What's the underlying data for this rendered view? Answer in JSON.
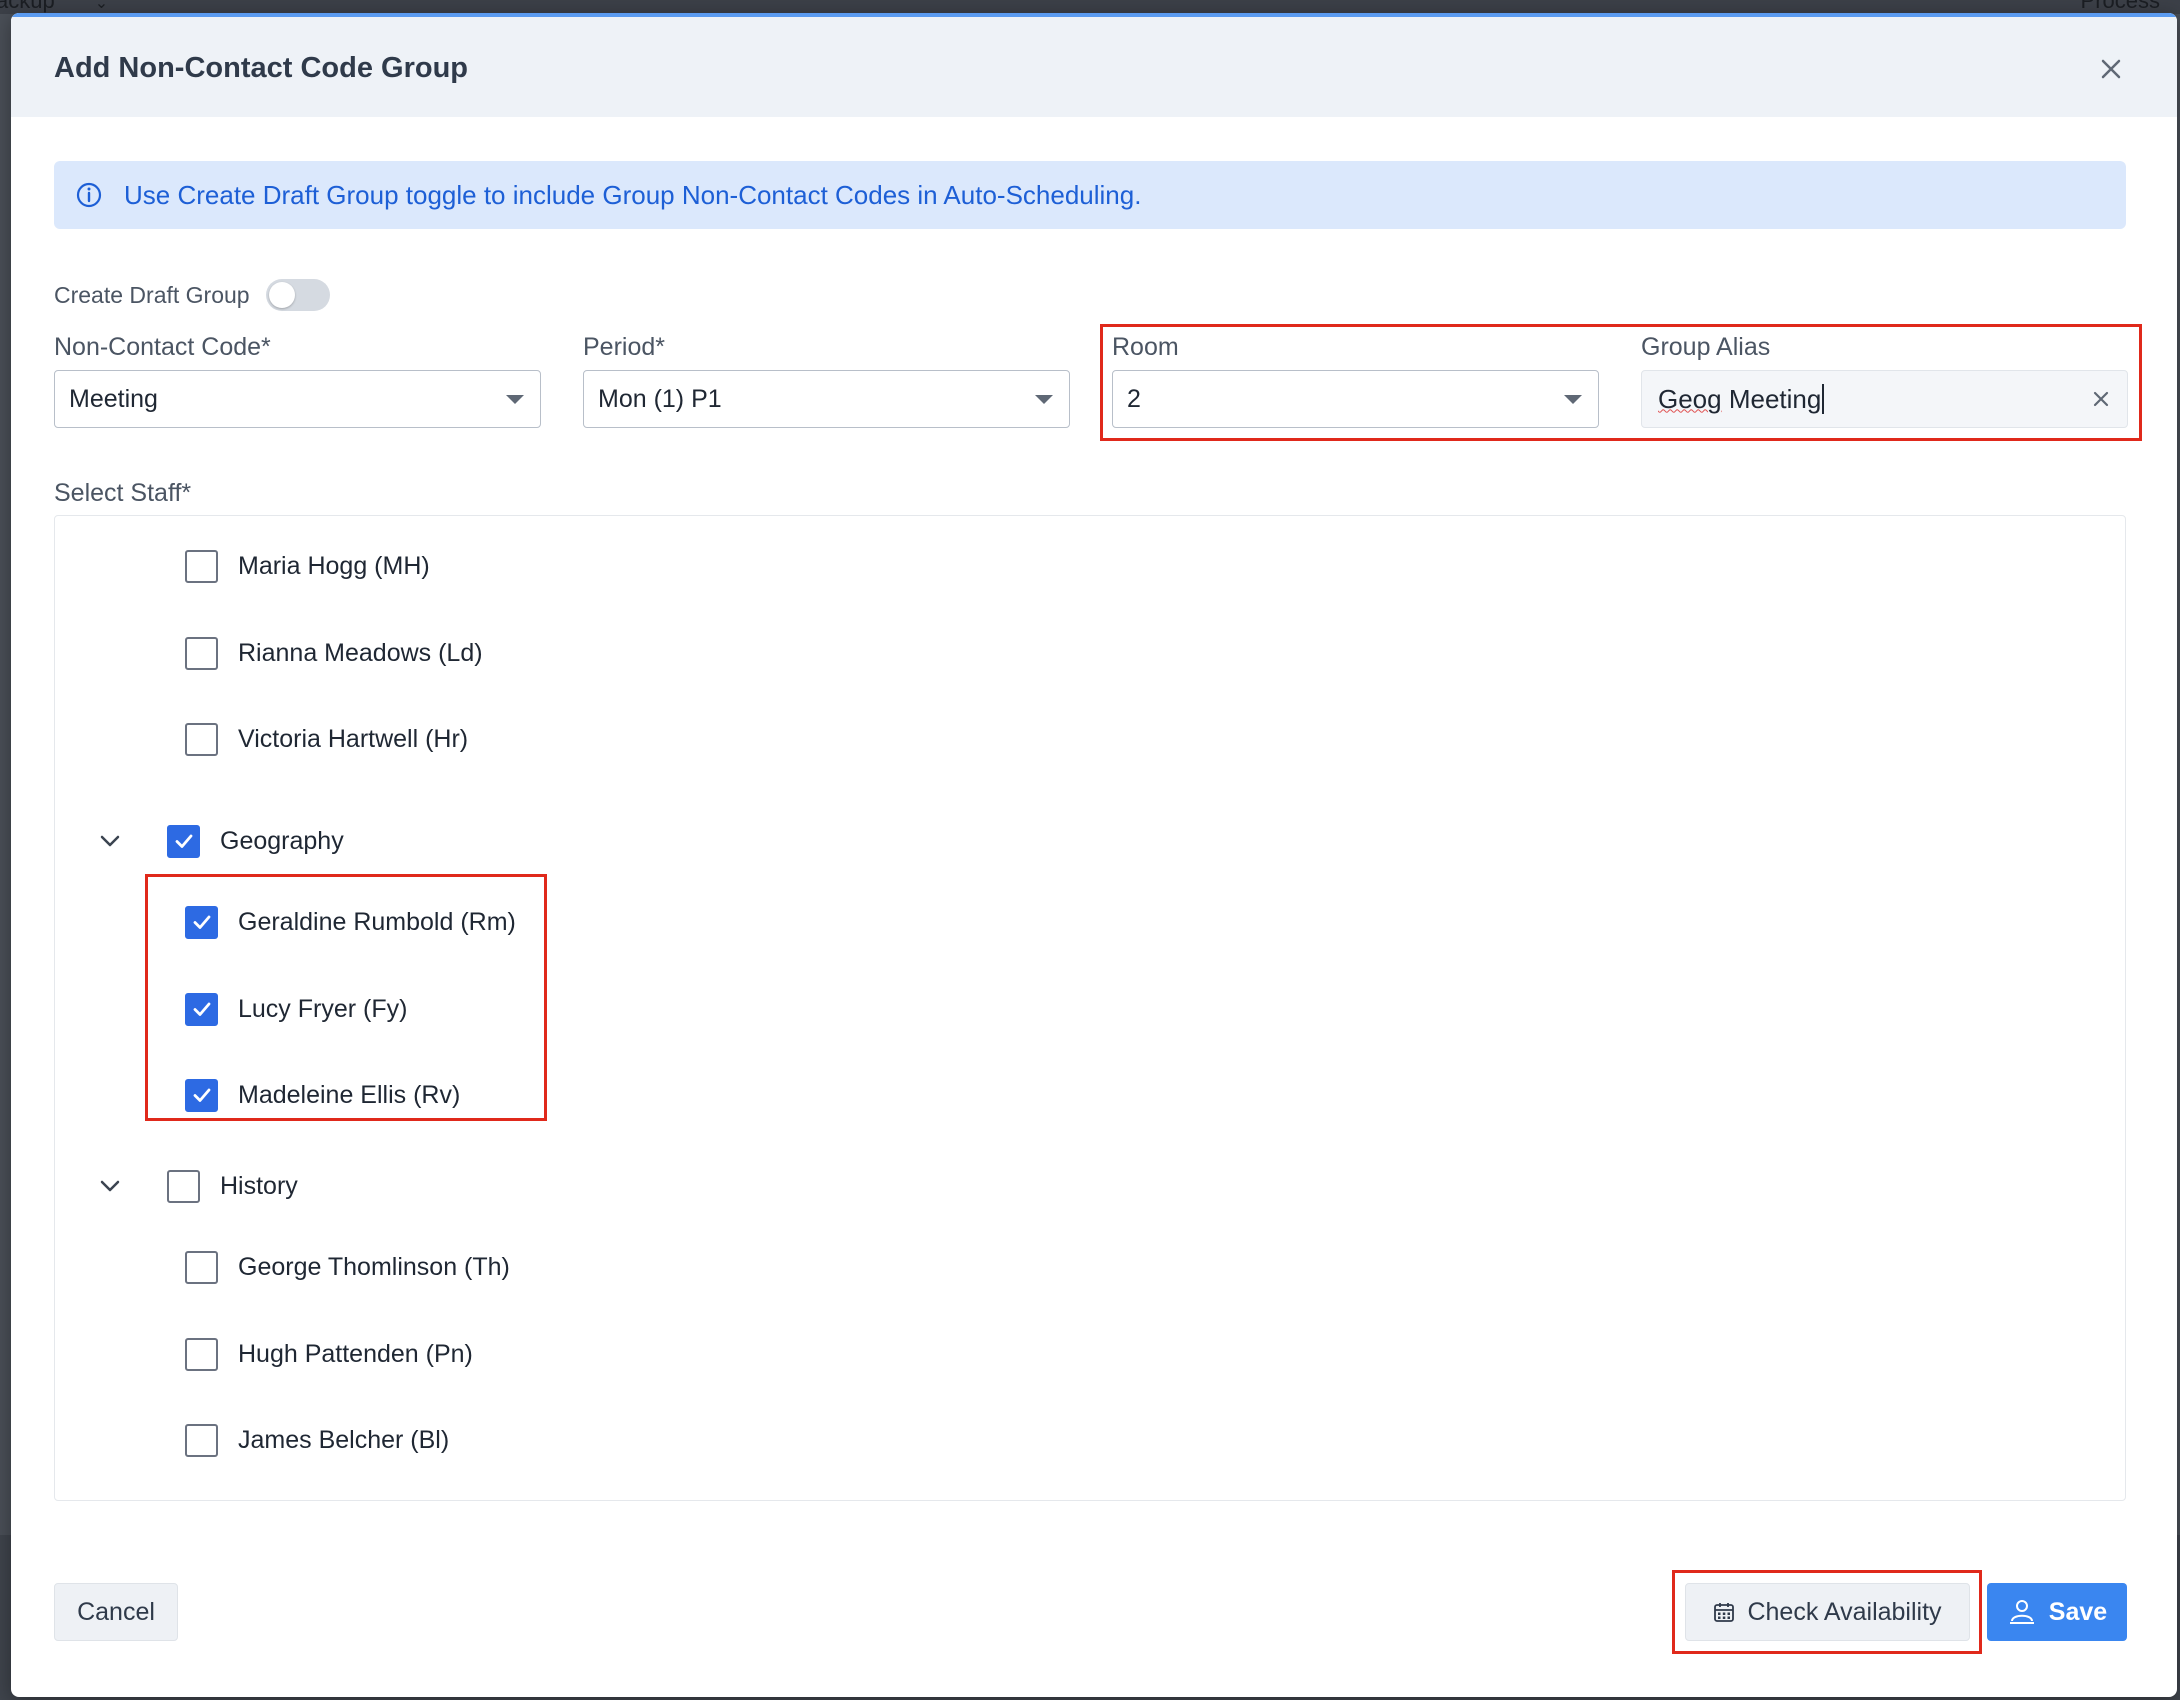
{
  "background": {
    "left_text": "ackup",
    "right_text": "Process"
  },
  "modal": {
    "title": "Add Non-Contact Code Group"
  },
  "alert": {
    "text": "Use Create Draft Group toggle to include Group Non-Contact Codes in Auto-Scheduling."
  },
  "draft_toggle": {
    "label": "Create Draft Group",
    "on": false
  },
  "fields": {
    "non_contact_code": {
      "label": "Non-Contact Code*",
      "value": "Meeting"
    },
    "period": {
      "label": "Period*",
      "value": "Mon (1) P1"
    },
    "room": {
      "label": "Room",
      "value": "2"
    },
    "group_alias": {
      "label": "Group Alias",
      "value_misspelled": "Geog",
      "value_rest": " Meeting"
    }
  },
  "staff": {
    "label": "Select Staff*",
    "items": [
      {
        "kind": "person",
        "label": "Maria Hogg (MH)",
        "checked": false
      },
      {
        "kind": "person",
        "label": "Rianna Meadows (Ld)",
        "checked": false
      },
      {
        "kind": "person",
        "label": "Victoria Hartwell (Hr)",
        "checked": false
      },
      {
        "kind": "group",
        "label": "Geography",
        "checked": true,
        "expanded": true
      },
      {
        "kind": "person",
        "label": "Geraldine Rumbold (Rm)",
        "checked": true
      },
      {
        "kind": "person",
        "label": "Lucy Fryer (Fy)",
        "checked": true
      },
      {
        "kind": "person",
        "label": "Madeleine Ellis (Rv)",
        "checked": true
      },
      {
        "kind": "group",
        "label": "History",
        "checked": false,
        "expanded": true
      },
      {
        "kind": "person",
        "label": "George Thomlinson (Th)",
        "checked": false
      },
      {
        "kind": "person",
        "label": "Hugh Pattenden (Pn)",
        "checked": false
      },
      {
        "kind": "person",
        "label": "James Belcher (Bl)",
        "checked": false
      }
    ]
  },
  "footer": {
    "cancel_label": "Cancel",
    "check_label": "Check Availability",
    "save_label": "Save"
  },
  "colors": {
    "accent": "#2d6ae3",
    "save_button": "#3a86f0",
    "highlight": "#e0291b",
    "alert_bg": "#dbe8fc"
  },
  "icons": [
    "close-icon",
    "info-icon",
    "chevron-down-icon",
    "calendar-icon",
    "save-user-icon",
    "clear-icon",
    "check-icon"
  ]
}
